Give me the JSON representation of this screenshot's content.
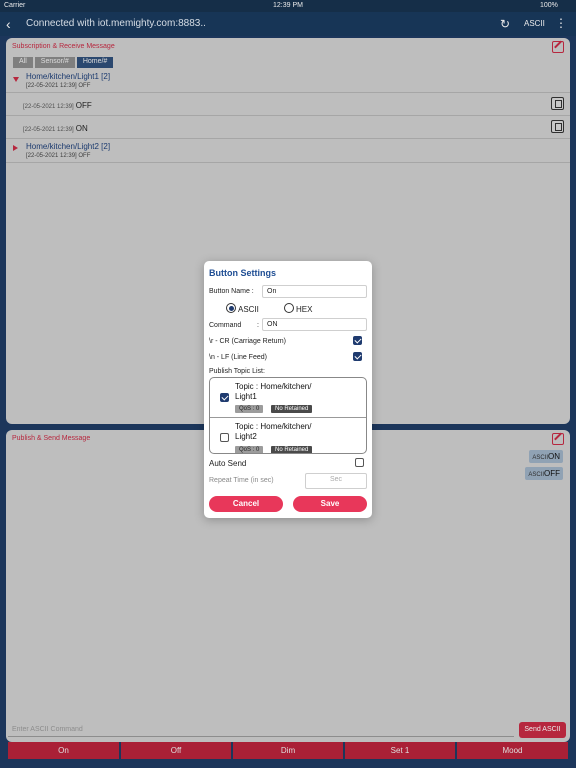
{
  "status_bar": {
    "carrier": "Carrier",
    "time": "12:39 PM",
    "battery": "100%"
  },
  "nav": {
    "title": "Connected with iot.memighty.com:8883..",
    "ascii_label": "ASCII"
  },
  "subscription": {
    "title": "Subscription & Receive Message",
    "filters": [
      "All",
      "Sensor/#",
      "Home/#"
    ],
    "topic1": {
      "name": "Home/kitchen/Light1 [2]",
      "last": "[22-05-2021 12:39] OFF"
    },
    "messages": [
      {
        "date": "[22-05-2021 12:39]",
        "value": "OFF"
      },
      {
        "date": "[22-05-2021 12:39]",
        "value": "ON"
      }
    ],
    "topic2": {
      "name": "Home/kitchen/Light2 [2]",
      "last": "[22-05-2021 12:39] OFF"
    }
  },
  "publish": {
    "title": "Publish & Send Message",
    "buttons": [
      {
        "prefix": "ASCII",
        "label": "ON"
      },
      {
        "prefix": "ASCII",
        "label": "OFF"
      }
    ],
    "input_placeholder": "Enter ASCII Command",
    "send_label": "Send ASCII"
  },
  "bottom_buttons": [
    "On",
    "Off",
    "Dim",
    "Set 1",
    "Mood"
  ],
  "dialog": {
    "title": "Button Settings",
    "button_name_label": "Button Name :",
    "button_name_value": "On",
    "ascii_label": "ASCII",
    "hex_label": "HEX",
    "command_label": "Command",
    "command_colon": ":",
    "command_value": "ON",
    "cr_label": "\\r - CR (Carriage Return)",
    "lf_label": "\\n - LF (Line Feed)",
    "topic_list_label": "Publish Topic List:",
    "topics": [
      {
        "title_line1": "Topic : Home/kitchen/",
        "title_line2": "Light1",
        "qos": "QoS : 0",
        "retained": "No Retained",
        "checked": true
      },
      {
        "title_line1": "Topic : Home/kitchen/",
        "title_line2": "Light2",
        "qos": "QoS : 0",
        "retained": "No Retained",
        "checked": false
      }
    ],
    "auto_send_label": "Auto Send",
    "repeat_label": "Repeat Time (in sec)",
    "repeat_placeholder": "Sec",
    "cancel_label": "Cancel",
    "save_label": "Save"
  }
}
